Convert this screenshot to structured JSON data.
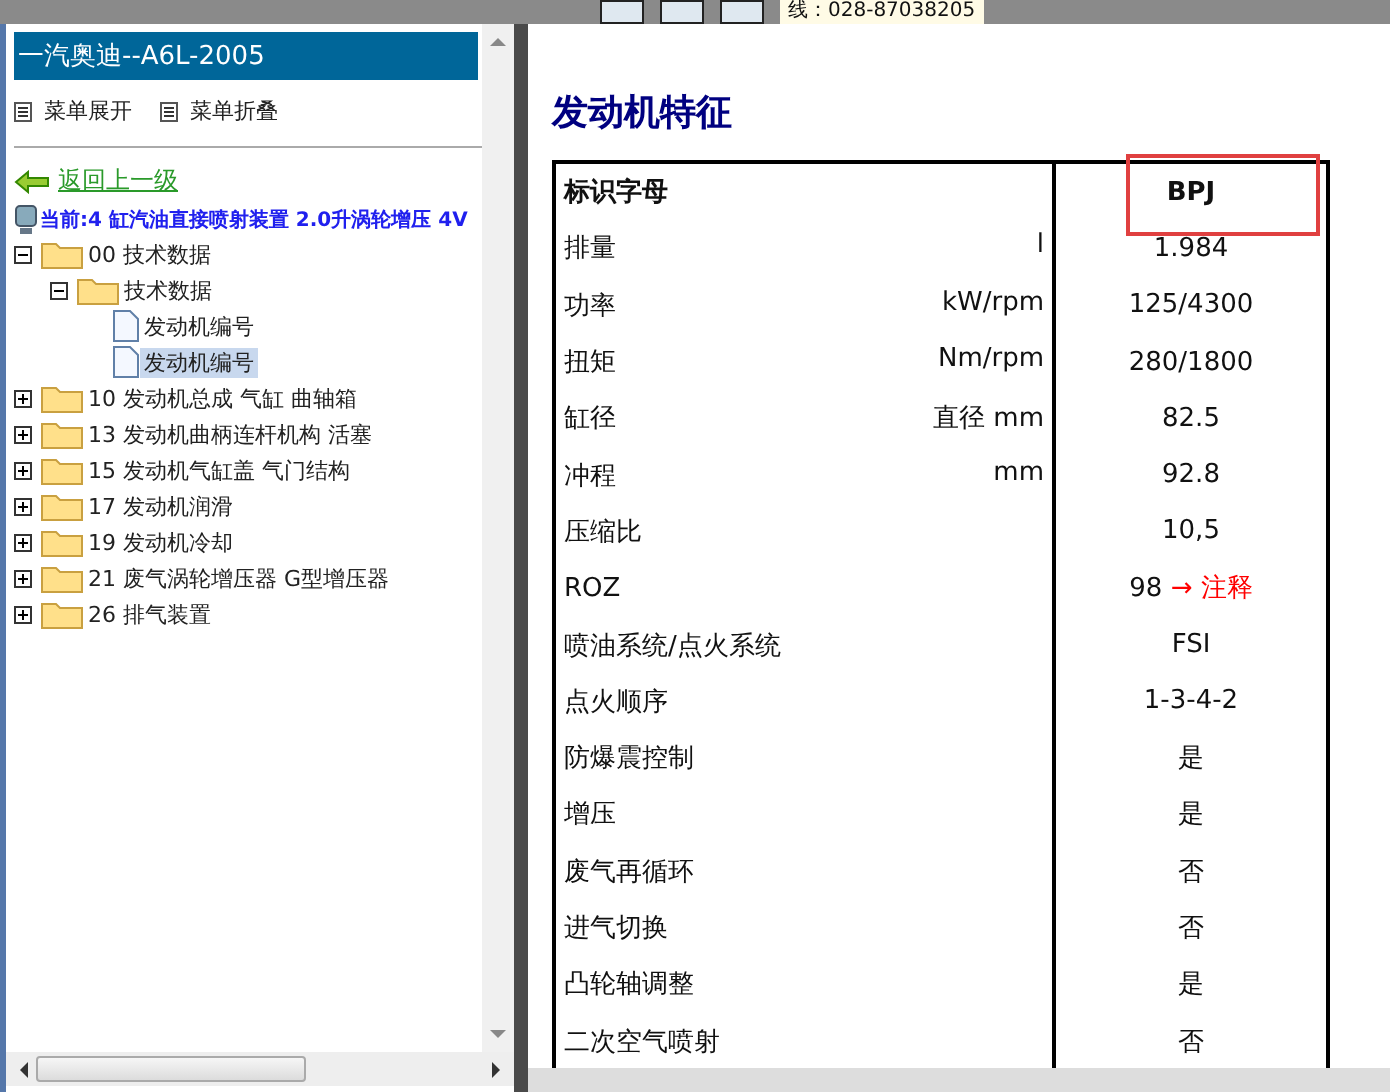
{
  "top_bar": {
    "hotline": "线：028-87038205"
  },
  "sidebar": {
    "title": "一汽奥迪--A6L-2005",
    "menu": [
      {
        "label": "菜单展开"
      },
      {
        "label": "菜单折叠"
      }
    ],
    "back_link": "返回上一级",
    "current": "当前:4 缸汽油直接喷射装置 2.0升涡轮增压 4V",
    "tree": [
      {
        "label": "00 技术数据",
        "kind": "folder",
        "expanded": true,
        "selected": false,
        "children": [
          {
            "label": "技术数据",
            "kind": "folder",
            "expanded": true,
            "selected": false,
            "children": [
              {
                "label": "发动机编号",
                "kind": "doc",
                "selected": false
              },
              {
                "label": "发动机编号",
                "kind": "doc",
                "selected": true
              }
            ]
          }
        ]
      },
      {
        "label": "10 发动机总成 气缸 曲轴箱",
        "kind": "folder",
        "expanded": false,
        "selected": false
      },
      {
        "label": "13 发动机曲柄连杆机构 活塞",
        "kind": "folder",
        "expanded": false,
        "selected": false
      },
      {
        "label": "15 发动机气缸盖 气门结构",
        "kind": "folder",
        "expanded": false,
        "selected": false
      },
      {
        "label": "17 发动机润滑",
        "kind": "folder",
        "expanded": false,
        "selected": false
      },
      {
        "label": "19 发动机冷却",
        "kind": "folder",
        "expanded": false,
        "selected": false
      },
      {
        "label": "21 废气涡轮增压器 G型增压器",
        "kind": "folder",
        "expanded": false,
        "selected": false
      },
      {
        "label": "26 排气装置",
        "kind": "folder",
        "expanded": false,
        "selected": false
      }
    ]
  },
  "content": {
    "title": "发动机特征",
    "rows": [
      {
        "label": "标识字母",
        "value": "BPJ",
        "header": true,
        "highlighted": true
      },
      {
        "label": "排量",
        "unit": "l",
        "value": "1.984",
        "header": false,
        "highlighted": false
      },
      {
        "label": "功率",
        "unit": "kW/rpm",
        "value": "125/4300",
        "header": false,
        "highlighted": false
      },
      {
        "label": "扭矩",
        "unit": "Nm/rpm",
        "value": "280/1800",
        "header": false,
        "highlighted": false
      },
      {
        "label": "缸径",
        "unit": "直径 mm",
        "value": "82.5",
        "header": false,
        "highlighted": false
      },
      {
        "label": "冲程",
        "unit": "mm",
        "value": "92.8",
        "header": false,
        "highlighted": false
      },
      {
        "label": "压缩比",
        "value": "10,5",
        "header": false,
        "highlighted": false
      },
      {
        "label": "ROZ",
        "value": "98",
        "link": "→ 注释",
        "header": false,
        "highlighted": false
      },
      {
        "label": "喷油系统/点火系统",
        "value": "FSI",
        "header": false,
        "highlighted": false
      },
      {
        "label": "点火顺序",
        "value": "1-3-4-2",
        "header": false,
        "highlighted": false
      },
      {
        "label": "防爆震控制",
        "value": "是",
        "header": false,
        "highlighted": false
      },
      {
        "label": "增压",
        "value": "是",
        "header": false,
        "highlighted": false
      },
      {
        "label": "废气再循环",
        "value": "否",
        "header": false,
        "highlighted": false
      },
      {
        "label": "进气切换",
        "value": "否",
        "header": false,
        "highlighted": false
      },
      {
        "label": "凸轮轴调整",
        "value": "是",
        "header": false,
        "highlighted": false
      },
      {
        "label": "二次空气喷射",
        "value": "否",
        "header": false,
        "highlighted": false
      }
    ]
  }
}
